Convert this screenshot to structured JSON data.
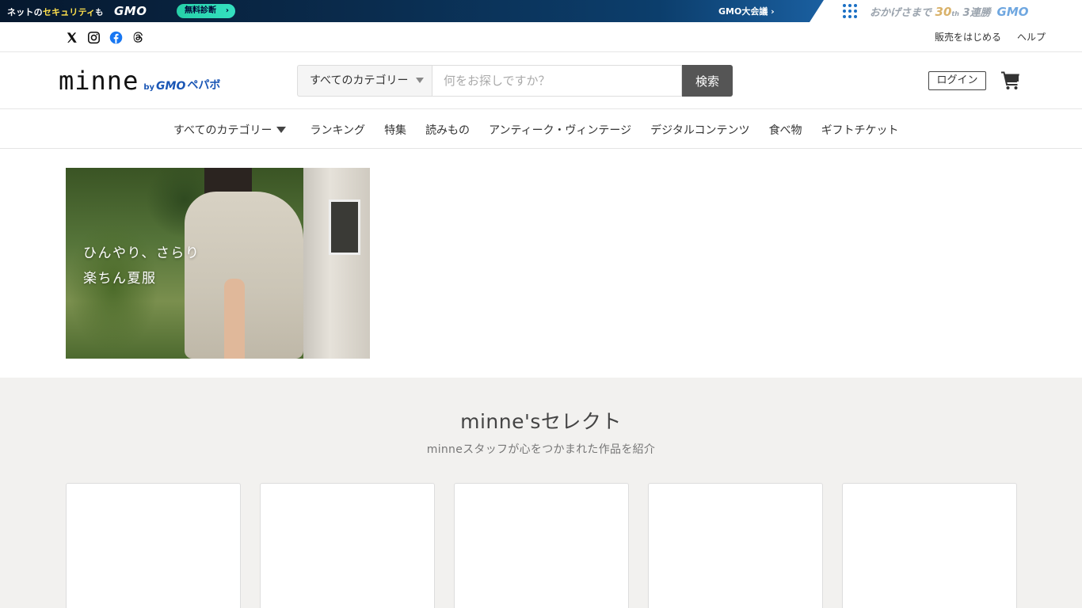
{
  "gmo_bar": {
    "net_security_pre": "ネットの",
    "net_security_hl": "セキュリティ",
    "net_security_post": "も",
    "gmo_logo": "GMO",
    "diagnosis_button": "無料診断",
    "diagnosis_arrow": "›",
    "conference": "GMO大会議 ›",
    "thanks_pre": "おかげさまで",
    "thanks_num": "30",
    "thanks_unit": "th",
    "thanks_post": "3連勝",
    "gmo_right_logo": "GMO",
    "accent_color": "#1a6fc4"
  },
  "util": {
    "social_icons": [
      "x-icon",
      "instagram-icon",
      "facebook-icon",
      "threads-icon"
    ],
    "start_selling": "販売をはじめる",
    "help": "ヘルプ"
  },
  "header": {
    "logo_text": "minne",
    "logo_by": "by",
    "logo_gmo": "GMO",
    "logo_pepabo": "ペパボ",
    "search_category": "すべてのカテゴリー",
    "search_placeholder": "何をお探しですか？",
    "search_button": "検索",
    "login": "ログイン"
  },
  "nav": {
    "items": [
      "すべてのカテゴリー",
      "ランキング",
      "特集",
      "読みもの",
      "アンティーク・ヴィンテージ",
      "デジタルコンテンツ",
      "食べ物",
      "ギフトチケット"
    ]
  },
  "banner": {
    "line1": "ひんやり、さらり",
    "line2": "楽ちん夏服"
  },
  "select": {
    "title": "minne'sセレクト",
    "subtitle": "minneスタッフが心をつかまれた作品を紹介"
  }
}
